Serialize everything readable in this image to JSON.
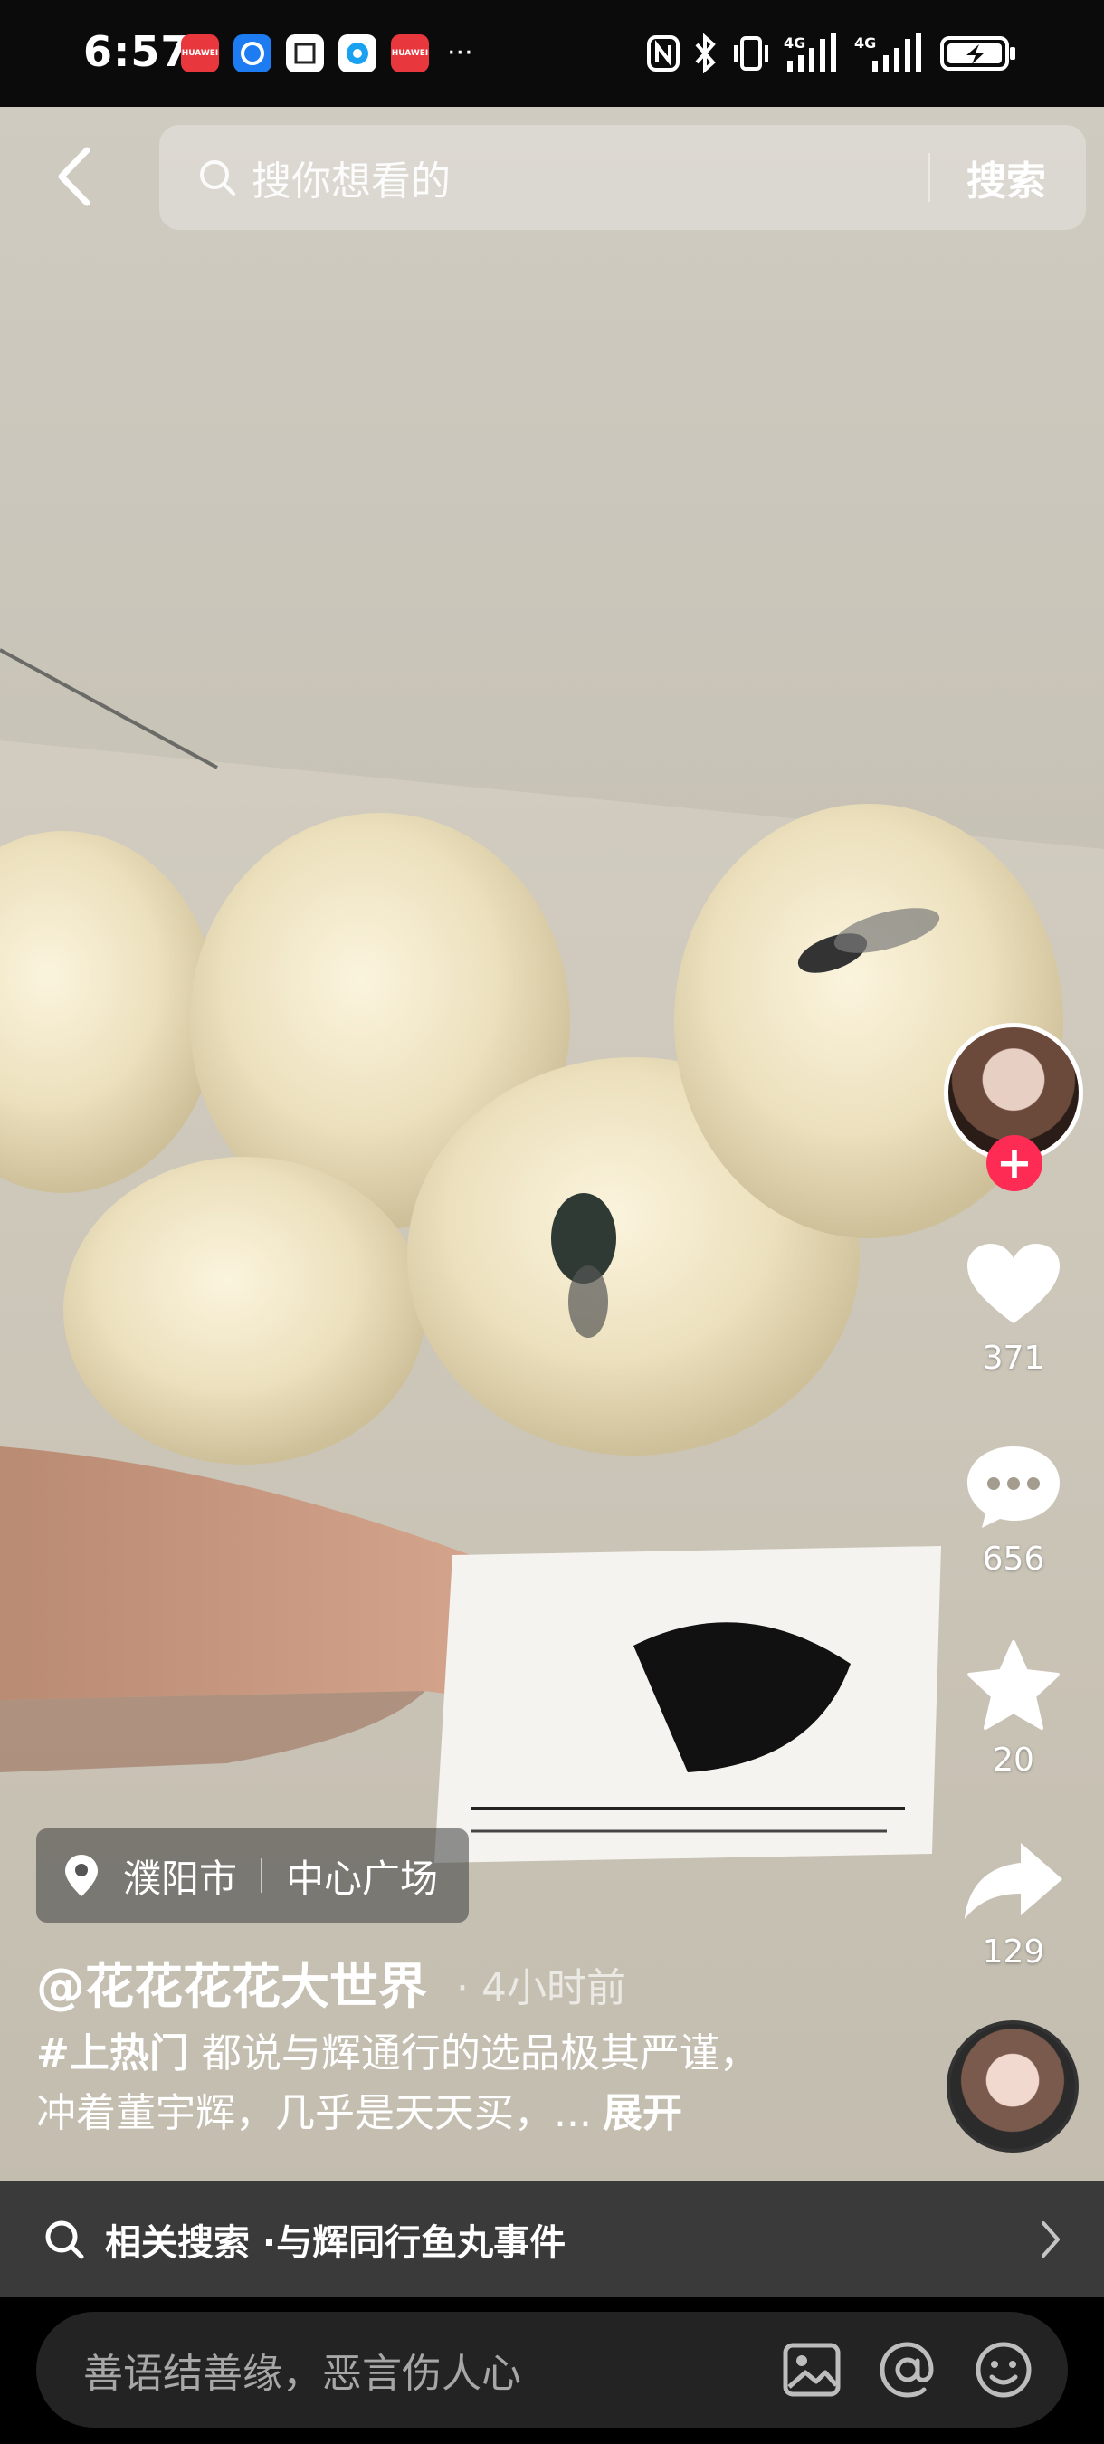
{
  "status_bar": {
    "time": "6:57",
    "apps": [
      "HUAWEI",
      "",
      "",
      "",
      "HUAWEI"
    ],
    "more": "···",
    "network_1": "4G",
    "network_2": "4G"
  },
  "top": {
    "search_placeholder": "搜你想看的",
    "search_button": "搜索"
  },
  "actions": {
    "likes": "371",
    "comments": "656",
    "favorites": "20",
    "shares": "129",
    "follow_symbol": "+"
  },
  "post": {
    "location_city": "濮阳市",
    "location_place": "中心广场",
    "author": "@花花花花大世界",
    "time_ago": "· 4小时前",
    "hashtag": "#上热门",
    "caption_line1": " 都说与辉通行的选品极其严谨，",
    "caption_line2": "冲着董宇辉，几乎是天天买，...",
    "expand": "展开"
  },
  "related": {
    "label": "相关搜索 · ",
    "term": "与辉同行鱼丸事件"
  },
  "comment_bar": {
    "placeholder": "善语结善缘，恶言伤人心"
  },
  "colors": {
    "accent": "#fe2c55",
    "heart": "#ffffff"
  },
  "icons": [
    "back-icon",
    "search-icon",
    "heart-icon",
    "comment-icon",
    "star-icon",
    "share-icon",
    "location-pin-icon",
    "image-icon",
    "at-icon",
    "emoji-icon",
    "chevron-right-icon"
  ]
}
